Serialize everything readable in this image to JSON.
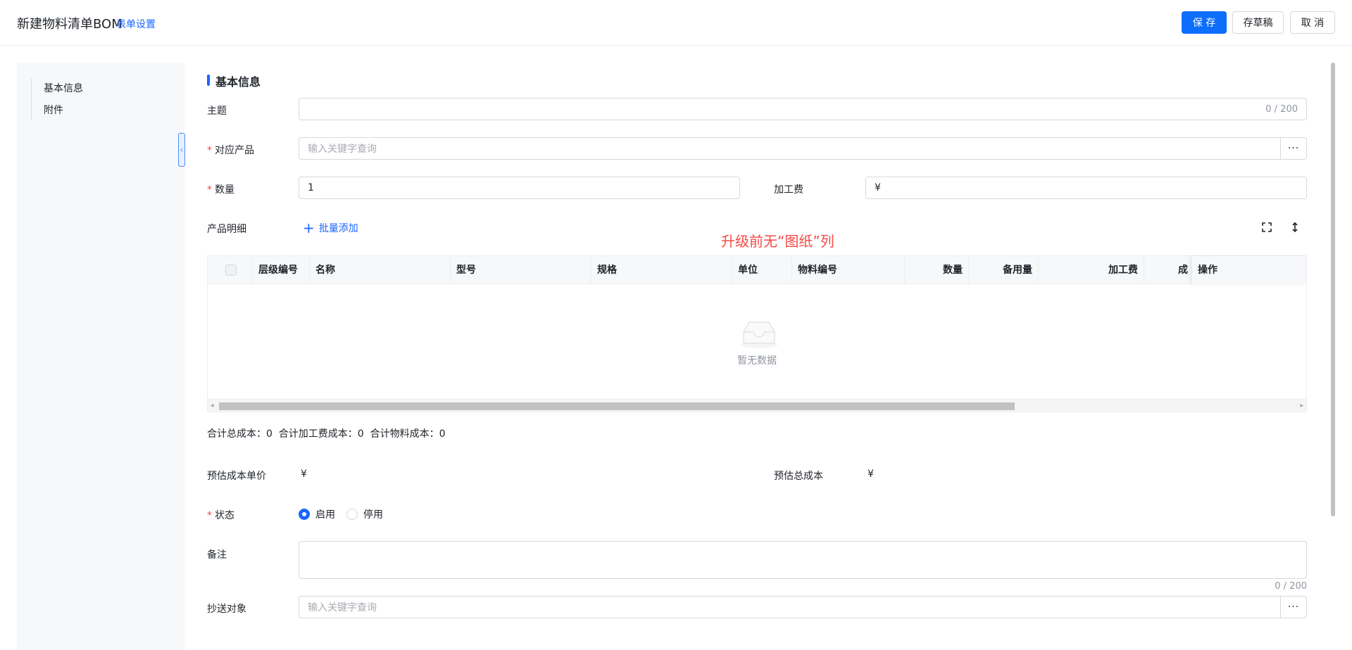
{
  "header": {
    "title": "新建物料清单BOM",
    "form_settings": "表单设置",
    "save": "保 存",
    "draft": "存草稿",
    "cancel": "取 消"
  },
  "nav": {
    "items": [
      "基本信息",
      "附件"
    ]
  },
  "section": {
    "title": "基本信息"
  },
  "form": {
    "subject": {
      "label": "主题",
      "value": "",
      "count": "0 / 200"
    },
    "product": {
      "label": "对应产品",
      "placeholder": "输入关键字查询"
    },
    "quantity": {
      "label": "数量",
      "value": "1"
    },
    "processing_fee": {
      "label": "加工费",
      "value": "¥"
    },
    "detail": {
      "label": "产品明细",
      "batch_add": "批量添加"
    },
    "annotation": "升级前无“图纸”列",
    "table": {
      "columns": [
        "层级编号",
        "名称",
        "型号",
        "规格",
        "单位",
        "物料编号",
        "数量",
        "备用量",
        "加工费",
        "成",
        "操作"
      ],
      "empty_text": "暂无数据"
    },
    "totals": "合计总成本：0  合计加工费成本：0  合计物料成本：0",
    "est_unit_cost": {
      "label": "预估成本单价",
      "value": "¥"
    },
    "est_total_cost": {
      "label": "预估总成本",
      "value": "¥"
    },
    "status": {
      "label": "状态",
      "options": [
        "启用",
        "停用"
      ],
      "selected": "启用"
    },
    "remark": {
      "label": "备注",
      "count": "0 / 200"
    },
    "cc": {
      "label": "抄送对象",
      "placeholder": "输入关键字查询"
    }
  },
  "colors": {
    "primary": "#1a66ff",
    "required": "#f54a45",
    "annotation": "#f54a45"
  }
}
